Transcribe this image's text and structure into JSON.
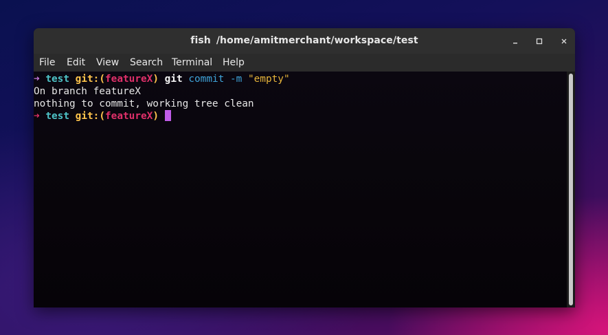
{
  "window": {
    "title_app": "fish",
    "title_path": "/home/amitmerchant/workspace/test"
  },
  "menu": {
    "items": [
      "File",
      "Edit",
      "View",
      "Search",
      "Terminal",
      "Help"
    ]
  },
  "terminal": {
    "lines": [
      {
        "arrow": "➜",
        "dir": "test",
        "git_open": "git:(",
        "branch": "featureX",
        "git_close": ")",
        "command": "git",
        "subcommand": "commit",
        "flag": "-m",
        "arg": "\"empty\""
      },
      {
        "text": "On branch featureX"
      },
      {
        "text": "nothing to commit, working tree clean"
      },
      {
        "arrow": "➜",
        "dir": "test",
        "git_open": "git:(",
        "branch": "featureX",
        "git_close": ")"
      }
    ]
  },
  "icons": {
    "minimize": "minimize-icon",
    "maximize": "maximize-icon",
    "close": "close-icon"
  },
  "colors": {
    "prompt_arrow_ok": "#c678dd",
    "prompt_arrow_err": "#e0306a",
    "dir": "#4ec3c7",
    "git_label": "#ffc44c",
    "branch": "#e0306a",
    "command": "#f4f4f4",
    "subcommand": "#3fa3d8",
    "string": "#e6b43a",
    "cursor": "#c05ce8"
  }
}
